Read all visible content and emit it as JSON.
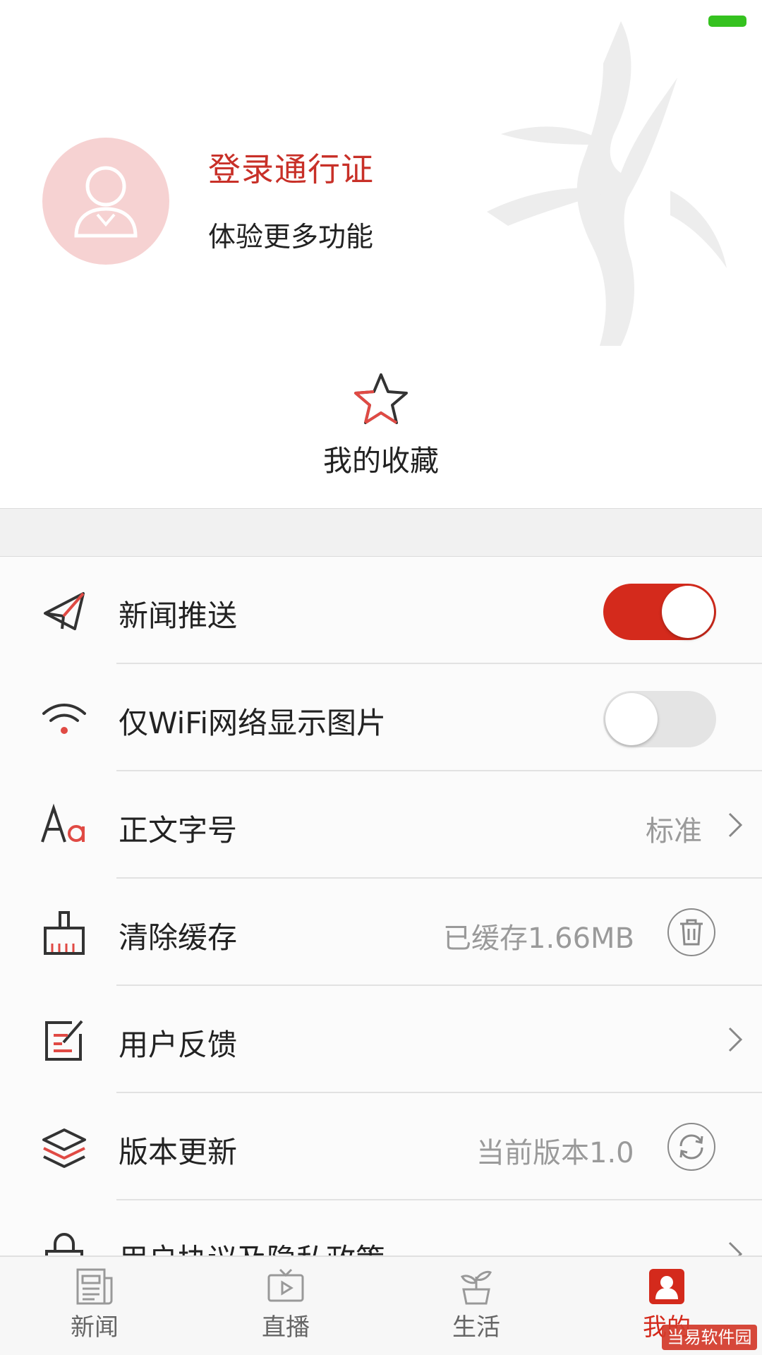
{
  "status_bar": {
    "battery_color": "#35c21f"
  },
  "profile": {
    "title": "登录通行证",
    "subtitle": "体验更多功能",
    "title_color": "#c83028",
    "avatar_bg": "#f6d2d2"
  },
  "favorites": {
    "label": "我的收藏",
    "icon": "star-icon"
  },
  "settings": [
    {
      "icon": "paper-plane-icon",
      "label": "新闻推送",
      "control": "toggle",
      "state": "on"
    },
    {
      "icon": "wifi-icon",
      "label": "仅WiFi网络显示图片",
      "control": "toggle",
      "state": "off"
    },
    {
      "icon": "font-size-icon",
      "label": "正文字号",
      "value": "标准",
      "control": "chevron"
    },
    {
      "icon": "broom-icon",
      "label": "清除缓存",
      "value": "已缓存1.66MB",
      "control": "trash-button"
    },
    {
      "icon": "edit-icon",
      "label": "用户反馈",
      "control": "chevron"
    },
    {
      "icon": "layers-icon",
      "label": "版本更新",
      "value": "当前版本1.0",
      "control": "refresh-button"
    },
    {
      "icon": "lock-icon",
      "label": "用户协议及隐私政策",
      "control": "chevron"
    }
  ],
  "tabs": [
    {
      "label": "新闻",
      "icon": "newspaper-icon",
      "active": false
    },
    {
      "label": "直播",
      "icon": "tv-icon",
      "active": false
    },
    {
      "label": "生活",
      "icon": "plant-icon",
      "active": false
    },
    {
      "label": "我的",
      "icon": "profile-icon",
      "active": true
    }
  ],
  "accent_color": "#d42a1c",
  "watermark_text": "当易软件园"
}
